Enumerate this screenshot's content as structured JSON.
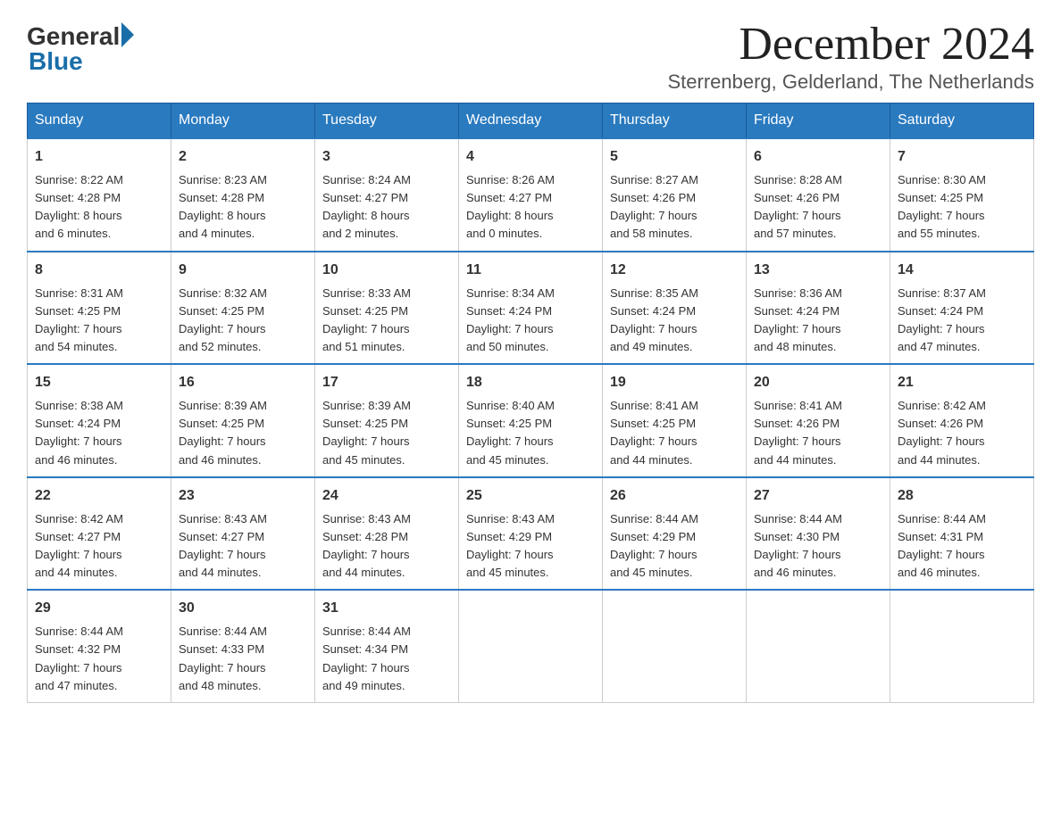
{
  "logo": {
    "general": "General",
    "blue": "Blue"
  },
  "title": "December 2024",
  "subtitle": "Sterrenberg, Gelderland, The Netherlands",
  "days_of_week": [
    "Sunday",
    "Monday",
    "Tuesday",
    "Wednesday",
    "Thursday",
    "Friday",
    "Saturday"
  ],
  "weeks": [
    [
      {
        "day": "1",
        "info": "Sunrise: 8:22 AM\nSunset: 4:28 PM\nDaylight: 8 hours\nand 6 minutes."
      },
      {
        "day": "2",
        "info": "Sunrise: 8:23 AM\nSunset: 4:28 PM\nDaylight: 8 hours\nand 4 minutes."
      },
      {
        "day": "3",
        "info": "Sunrise: 8:24 AM\nSunset: 4:27 PM\nDaylight: 8 hours\nand 2 minutes."
      },
      {
        "day": "4",
        "info": "Sunrise: 8:26 AM\nSunset: 4:27 PM\nDaylight: 8 hours\nand 0 minutes."
      },
      {
        "day": "5",
        "info": "Sunrise: 8:27 AM\nSunset: 4:26 PM\nDaylight: 7 hours\nand 58 minutes."
      },
      {
        "day": "6",
        "info": "Sunrise: 8:28 AM\nSunset: 4:26 PM\nDaylight: 7 hours\nand 57 minutes."
      },
      {
        "day": "7",
        "info": "Sunrise: 8:30 AM\nSunset: 4:25 PM\nDaylight: 7 hours\nand 55 minutes."
      }
    ],
    [
      {
        "day": "8",
        "info": "Sunrise: 8:31 AM\nSunset: 4:25 PM\nDaylight: 7 hours\nand 54 minutes."
      },
      {
        "day": "9",
        "info": "Sunrise: 8:32 AM\nSunset: 4:25 PM\nDaylight: 7 hours\nand 52 minutes."
      },
      {
        "day": "10",
        "info": "Sunrise: 8:33 AM\nSunset: 4:25 PM\nDaylight: 7 hours\nand 51 minutes."
      },
      {
        "day": "11",
        "info": "Sunrise: 8:34 AM\nSunset: 4:24 PM\nDaylight: 7 hours\nand 50 minutes."
      },
      {
        "day": "12",
        "info": "Sunrise: 8:35 AM\nSunset: 4:24 PM\nDaylight: 7 hours\nand 49 minutes."
      },
      {
        "day": "13",
        "info": "Sunrise: 8:36 AM\nSunset: 4:24 PM\nDaylight: 7 hours\nand 48 minutes."
      },
      {
        "day": "14",
        "info": "Sunrise: 8:37 AM\nSunset: 4:24 PM\nDaylight: 7 hours\nand 47 minutes."
      }
    ],
    [
      {
        "day": "15",
        "info": "Sunrise: 8:38 AM\nSunset: 4:24 PM\nDaylight: 7 hours\nand 46 minutes."
      },
      {
        "day": "16",
        "info": "Sunrise: 8:39 AM\nSunset: 4:25 PM\nDaylight: 7 hours\nand 46 minutes."
      },
      {
        "day": "17",
        "info": "Sunrise: 8:39 AM\nSunset: 4:25 PM\nDaylight: 7 hours\nand 45 minutes."
      },
      {
        "day": "18",
        "info": "Sunrise: 8:40 AM\nSunset: 4:25 PM\nDaylight: 7 hours\nand 45 minutes."
      },
      {
        "day": "19",
        "info": "Sunrise: 8:41 AM\nSunset: 4:25 PM\nDaylight: 7 hours\nand 44 minutes."
      },
      {
        "day": "20",
        "info": "Sunrise: 8:41 AM\nSunset: 4:26 PM\nDaylight: 7 hours\nand 44 minutes."
      },
      {
        "day": "21",
        "info": "Sunrise: 8:42 AM\nSunset: 4:26 PM\nDaylight: 7 hours\nand 44 minutes."
      }
    ],
    [
      {
        "day": "22",
        "info": "Sunrise: 8:42 AM\nSunset: 4:27 PM\nDaylight: 7 hours\nand 44 minutes."
      },
      {
        "day": "23",
        "info": "Sunrise: 8:43 AM\nSunset: 4:27 PM\nDaylight: 7 hours\nand 44 minutes."
      },
      {
        "day": "24",
        "info": "Sunrise: 8:43 AM\nSunset: 4:28 PM\nDaylight: 7 hours\nand 44 minutes."
      },
      {
        "day": "25",
        "info": "Sunrise: 8:43 AM\nSunset: 4:29 PM\nDaylight: 7 hours\nand 45 minutes."
      },
      {
        "day": "26",
        "info": "Sunrise: 8:44 AM\nSunset: 4:29 PM\nDaylight: 7 hours\nand 45 minutes."
      },
      {
        "day": "27",
        "info": "Sunrise: 8:44 AM\nSunset: 4:30 PM\nDaylight: 7 hours\nand 46 minutes."
      },
      {
        "day": "28",
        "info": "Sunrise: 8:44 AM\nSunset: 4:31 PM\nDaylight: 7 hours\nand 46 minutes."
      }
    ],
    [
      {
        "day": "29",
        "info": "Sunrise: 8:44 AM\nSunset: 4:32 PM\nDaylight: 7 hours\nand 47 minutes."
      },
      {
        "day": "30",
        "info": "Sunrise: 8:44 AM\nSunset: 4:33 PM\nDaylight: 7 hours\nand 48 minutes."
      },
      {
        "day": "31",
        "info": "Sunrise: 8:44 AM\nSunset: 4:34 PM\nDaylight: 7 hours\nand 49 minutes."
      },
      null,
      null,
      null,
      null
    ]
  ]
}
